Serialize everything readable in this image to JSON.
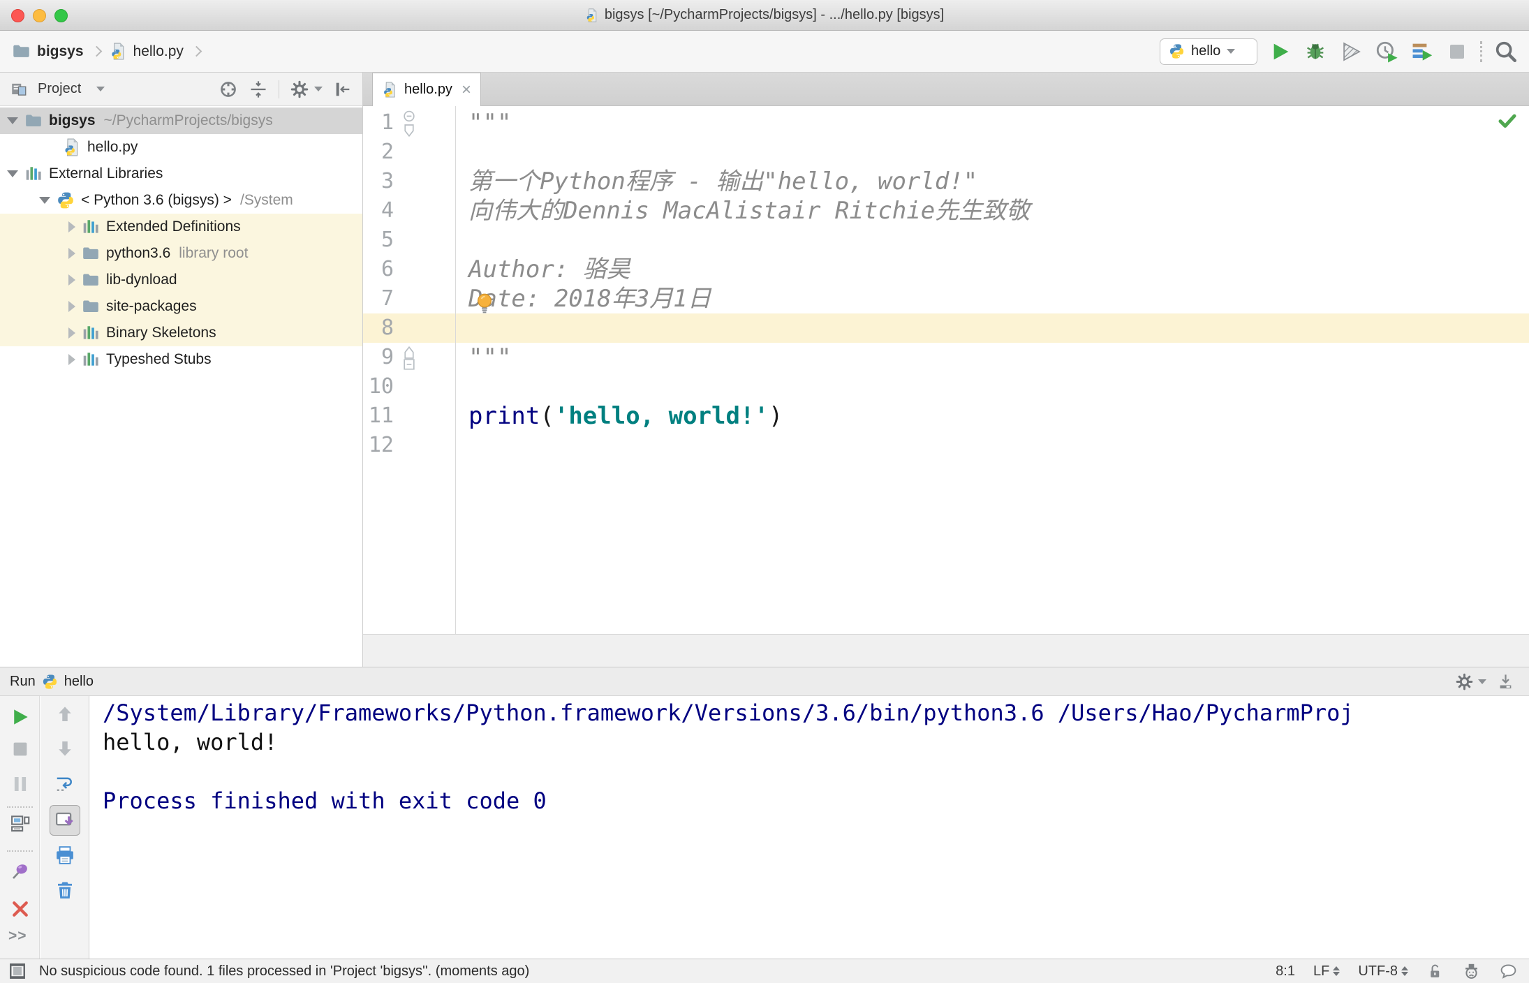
{
  "title_bar": {
    "title": "bigsys [~/PycharmProjects/bigsys] - .../hello.py [bigsys]"
  },
  "navbar": {
    "breadcrumb": {
      "project": "bigsys",
      "file": "hello.py"
    },
    "run_config": "hello"
  },
  "project_panel": {
    "title": "Project",
    "tree": [
      {
        "label": "bigsys",
        "suffix": "~/PycharmProjects/bigsys"
      },
      {
        "label": "hello.py"
      },
      {
        "label": "External Libraries"
      },
      {
        "label": "< Python 3.6 (bigsys) >",
        "suffix": "/System"
      },
      {
        "label": "Extended Definitions"
      },
      {
        "label": "python3.6",
        "suffix": "library root"
      },
      {
        "label": "lib-dynload"
      },
      {
        "label": "site-packages"
      },
      {
        "label": "Binary Skeletons"
      },
      {
        "label": "Typeshed Stubs"
      }
    ]
  },
  "editor": {
    "tab": "hello.py",
    "line_numbers": [
      "1",
      "2",
      "3",
      "4",
      "5",
      "6",
      "7",
      "8",
      "9",
      "10",
      "11",
      "12"
    ],
    "code": {
      "doc_open": "\"\"\"",
      "line3": "第一个Python程序 - 输出\"hello, world!\"",
      "line4": "向伟大的Dennis MacAlistair Ritchie先生致敬",
      "line6": "Author: 骆昊",
      "line7": "Date: 2018年3月1日",
      "doc_close": "\"\"\"",
      "print_kw": "print",
      "paren_open": "(",
      "string": "'hello, world!'",
      "paren_close": ")"
    }
  },
  "run_panel": {
    "label": "Run",
    "config": "hello",
    "console": {
      "line1": "/System/Library/Frameworks/Python.framework/Versions/3.6/bin/python3.6 /Users/Hao/PycharmProj",
      "line2": "hello, world!",
      "line4": "Process finished with exit code 0"
    }
  },
  "status_bar": {
    "message": "No suspicious code found. 1 files processed in 'Project 'bigsys''. (moments ago)",
    "caret": "8:1",
    "line_ending": "LF",
    "encoding": "UTF-8"
  },
  "icons": {
    "tab_close": "×",
    "more": ">>"
  },
  "colors": {
    "accent_green": "#3fae4a",
    "keyword": "#000080",
    "string": "#008080",
    "console_info": "#000080",
    "library_highlight": "#fbf6df",
    "current_line": "#fcf3d4",
    "selection": "#d5d5d5"
  }
}
